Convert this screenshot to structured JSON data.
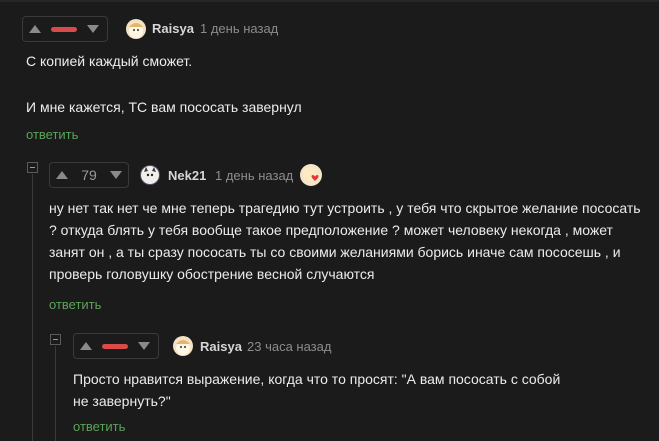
{
  "comments": [
    {
      "username": "Raisya",
      "time": "1 день назад",
      "lines": [
        "С копией каждый сможет.",
        "И мне кажется, ТС вам пососать завернул"
      ],
      "reply_label": "ответить",
      "rating_display": "bar"
    },
    {
      "username": "Nek21",
      "time": "1 день назад",
      "score": "79",
      "text": "ну нет так нет че мне теперь трагедию тут устроить , у тебя что скрытое желание пососать ? откуда блять у тебя вообще такое предположение ? может человеку некогда , может занят он , а ты сразу пососать ты со своими желаниями борись иначе сам пососешь , и проверь головушку обострение весной случаются",
      "reply_label": "ответить"
    },
    {
      "username": "Raisya",
      "time": "23 часа назад",
      "text": "Просто нравится выражение, когда что то просят: \"А вам пососать с собой не завернуть?\"",
      "reply_label": "ответить",
      "rating_display": "bar"
    }
  ],
  "icons": {
    "upvote": "triangle-up",
    "downvote": "triangle-down",
    "collapse": "minus-square",
    "avatar_raisya": "cartoon-avatar",
    "avatar_nek21": "cat-avatar",
    "badge": "heart-badge"
  },
  "colors": {
    "background": "#1b1b1b",
    "text": "#ececec",
    "reply_link": "#5aa35a",
    "rating_bar": "#d94a4a",
    "muted": "#8c8c8c"
  }
}
